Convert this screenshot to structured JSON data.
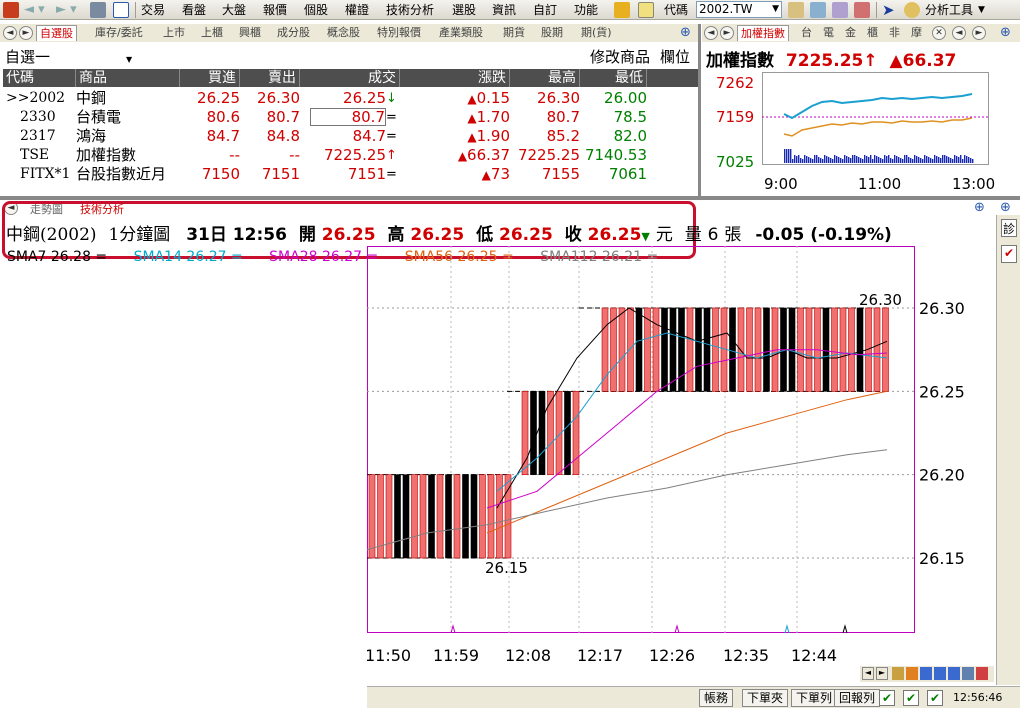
{
  "toolbar": {
    "menus": [
      "交易",
      "看盤",
      "大盤",
      "報價",
      "個股",
      "權證",
      "技術分析",
      "選股",
      "資訊",
      "自訂",
      "功能"
    ],
    "code_label": "代碼",
    "symbol": "2002.TW",
    "analysis_tool": "分析工具"
  },
  "top_tabs": [
    "自選股",
    "庫存/委託",
    "上市",
    "上櫃",
    "興櫃",
    "成分股",
    "概念股",
    "特別報價",
    "產業類股",
    "期貨",
    "股期",
    "期(貨)"
  ],
  "watchlist": {
    "name": "自選一",
    "modify": "修改商品",
    "column_pos": "欄位",
    "headers": [
      "代碼",
      "商品",
      "買進",
      "賣出",
      "成交",
      "漲跌",
      "最高",
      "最低"
    ],
    "rows": [
      {
        "code": ">>2002",
        "name": "中鋼",
        "bid": "26.25",
        "ask": "26.30",
        "last": "26.25",
        "last_mark": "↓",
        "chg_mark": "▲",
        "chg": "0.15",
        "high": "26.30",
        "low": "26.00",
        "color": "#d00000",
        "last_mark_color": "#008000",
        "low_color": "#008000"
      },
      {
        "code": "2330",
        "name": "台積電",
        "bid": "80.6",
        "ask": "80.7",
        "last": "80.7",
        "last_mark": "=",
        "chg_mark": "▲",
        "chg": "1.70",
        "high": "80.7",
        "low": "78.5",
        "color": "#d00000",
        "last_mark_color": "#000000",
        "low_color": "#008000"
      },
      {
        "code": "2317",
        "name": "鴻海",
        "bid": "84.7",
        "ask": "84.8",
        "last": "84.7",
        "last_mark": "=",
        "chg_mark": "▲",
        "chg": "1.90",
        "high": "85.2",
        "low": "82.0",
        "color": "#d00000",
        "last_mark_color": "#000000",
        "low_color": "#008000"
      },
      {
        "code": "TSE",
        "name": "加權指數",
        "bid": "--",
        "ask": "--",
        "last": "7225.25",
        "last_mark": "↑",
        "chg_mark": "▲",
        "chg": "66.37",
        "high": "7225.25",
        "low": "7140.53",
        "color": "#d00000",
        "last_mark_color": "#d00000",
        "low_color": "#008000"
      },
      {
        "code": "FITX*1",
        "name": "台股指數近月",
        "bid": "7150",
        "ask": "7151",
        "last": "7151",
        "last_mark": "=",
        "chg_mark": "▲",
        "chg": "73",
        "high": "7155",
        "low": "7061",
        "color": "#d00000",
        "last_mark_color": "#000000",
        "low_color": "#008000"
      }
    ]
  },
  "index_panel": {
    "tabs": [
      "加權指數",
      "台",
      "電",
      "金",
      "櫃",
      "非",
      "摩"
    ],
    "title": "加權指數",
    "value": "7225.25",
    "arrow": "↑",
    "change_mark": "▲",
    "change": "66.37",
    "y_labels": [
      "7262",
      "7159",
      "7025"
    ],
    "x_labels": [
      "9:00",
      "11:00",
      "13:00"
    ]
  },
  "lower_tabs": [
    "走勢圖",
    "技術分析"
  ],
  "kline_info": {
    "title": "中鋼(2002)",
    "period": "1分鐘圖",
    "date": "31日",
    "time": "12:56",
    "open_label": "開",
    "open": "26.25",
    "high_label": "高",
    "high": "26.25",
    "low_label": "低",
    "low": "26.25",
    "close_label": "收",
    "close": "26.25",
    "close_mark": "▼",
    "unit": "元",
    "vol_label": "量",
    "vol": "6",
    "vol_unit": "張",
    "change": "-0.05",
    "change_pct": "(-0.19%)"
  },
  "sma_legend": [
    {
      "label": "SMA7 26.28 =",
      "color": "#000000"
    },
    {
      "label": "SMA14 26.27 =",
      "color": "#00aacc"
    },
    {
      "label": "SMA28 26.27 =",
      "color": "#cc00cc"
    },
    {
      "label": "SMA56 26.25 =",
      "color": "#e06010"
    },
    {
      "label": "SMA112 26.21 =",
      "color": "#808080"
    }
  ],
  "chart_data": {
    "type": "candlestick",
    "y_ticks": [
      "26.30",
      "26.25",
      "26.20",
      "26.15"
    ],
    "x_ticks": [
      "11:50",
      "11:59",
      "12:08",
      "12:17",
      "12:26",
      "12:35",
      "12:44"
    ],
    "annotations": [
      "26.30",
      "26.15"
    ],
    "ylim": [
      26.13,
      26.32
    ]
  },
  "statusbar": {
    "buttons": [
      "帳務",
      "下單夾",
      "下單列",
      "回報列"
    ],
    "time": "12:56:46"
  },
  "side": {
    "label": "診"
  }
}
